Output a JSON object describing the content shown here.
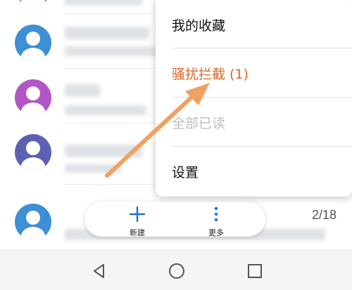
{
  "menu": {
    "items": [
      {
        "label": "我的收藏"
      },
      {
        "label": "骚扰拦截 (1)"
      },
      {
        "label": "全部已读"
      },
      {
        "label": "设置"
      }
    ]
  },
  "toolbar": {
    "new_label": "新建",
    "more_label": "更多"
  },
  "list": {
    "counter": "2/18"
  },
  "colors": {
    "accent": "#d9682a",
    "arrow": "#f0a060",
    "avatar_blue": "#3d8fd6",
    "avatar_purple": "#b157c5",
    "avatar_indigo": "#5d61b3"
  }
}
